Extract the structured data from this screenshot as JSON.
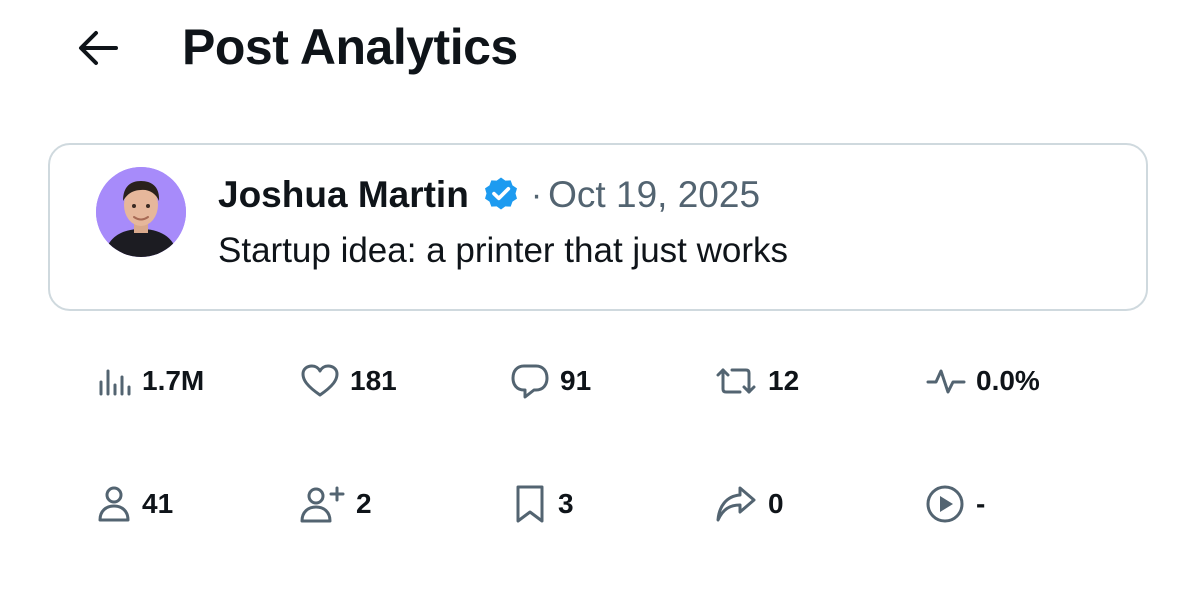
{
  "header": {
    "title": "Post Analytics",
    "back_icon": "arrow-left-icon"
  },
  "post": {
    "author": "Joshua Martin",
    "verified_icon": "verified-badge-icon",
    "separator": "·",
    "date": "Oct 19, 2025",
    "text": "Startup idea: a printer that just works"
  },
  "metrics_row1": [
    {
      "icon": "bar-chart-icon",
      "value": "1.7M"
    },
    {
      "icon": "heart-icon",
      "value": "181"
    },
    {
      "icon": "comment-icon",
      "value": "91"
    },
    {
      "icon": "repost-icon",
      "value": "12"
    },
    {
      "icon": "activity-icon",
      "value": "0.0%"
    }
  ],
  "metrics_row2": [
    {
      "icon": "person-icon",
      "value": "41"
    },
    {
      "icon": "follow-icon",
      "value": "2"
    },
    {
      "icon": "bookmark-icon",
      "value": "3"
    },
    {
      "icon": "share-icon",
      "value": "0"
    },
    {
      "icon": "play-icon",
      "value": "-"
    }
  ],
  "colors": {
    "text": "#0f1419",
    "secondary": "#536471",
    "border": "#cfd9de",
    "verified": "#1d9bf0",
    "avatar_bg": "#a78bfa"
  }
}
